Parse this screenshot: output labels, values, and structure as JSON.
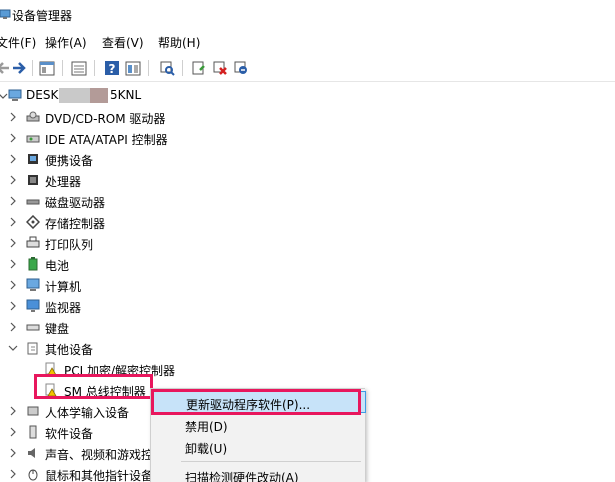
{
  "window": {
    "title": "设备管理器"
  },
  "menu": [
    "文件(F)",
    "操作(A)",
    "查看(V)",
    "帮助(H)"
  ],
  "toolbar": [
    "back-icon",
    "forward-icon",
    "properties-icon",
    "view-icon",
    "help-icon",
    "view2-icon",
    "scan-icon",
    "update-driver-icon",
    "disable-icon",
    "uninstall-icon"
  ],
  "tree": {
    "root": "DESK",
    "root_suffix": "5KNL",
    "items": [
      "DVD/CD-ROM 驱动器",
      "IDE ATA/ATAPI 控制器",
      "便携设备",
      "处理器",
      "磁盘驱动器",
      "存储控制器",
      "打印队列",
      "电池",
      "计算机",
      "监视器",
      "键盘",
      "其他设备",
      "PCI 加密/解密控制器",
      "SM 总线控制器",
      "人体学输入设备",
      "软件设备",
      "声音、视频和游戏控",
      "鼠标和其他指针设备"
    ]
  },
  "context_menu": {
    "items": [
      "更新驱动程序软件(P)...",
      "禁用(D)",
      "卸载(U)",
      "扫描检测硬件改动(A)"
    ]
  },
  "colors": {
    "highlight_border": "#e8175d",
    "menu_hover": "#c7e3f9",
    "menu_hover_border": "#3c9be5"
  }
}
